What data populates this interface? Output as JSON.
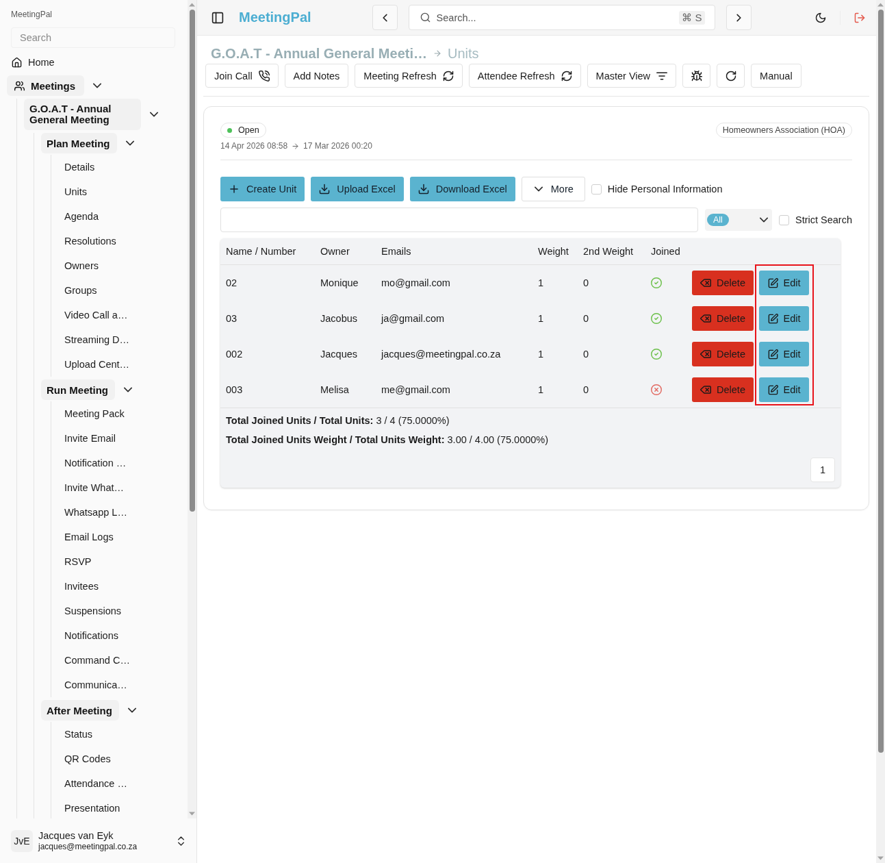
{
  "sidebar": {
    "app_name": "MeetingPal",
    "search": {
      "placeholder": "Search"
    },
    "nav": [
      {
        "kind": "link",
        "label": "Home"
      },
      {
        "kind": "group",
        "label": "Meetings",
        "expanded": true,
        "children": [
          {
            "kind": "group",
            "label": "G.O.A.T - Annual General Meeting",
            "expanded": true,
            "children": [
              {
                "kind": "group",
                "label": "Plan Meeting",
                "expanded": true,
                "children": [
                  {
                    "kind": "link",
                    "label": "Details"
                  },
                  {
                    "kind": "link",
                    "label": "Units"
                  },
                  {
                    "kind": "link",
                    "label": "Agenda"
                  },
                  {
                    "kind": "link",
                    "label": "Resolutions"
                  },
                  {
                    "kind": "link",
                    "label": "Owners"
                  },
                  {
                    "kind": "link",
                    "label": "Groups"
                  },
                  {
                    "kind": "link",
                    "label": "Video Call a…"
                  },
                  {
                    "kind": "link",
                    "label": "Streaming D…"
                  },
                  {
                    "kind": "link",
                    "label": "Upload Cent…"
                  }
                ]
              },
              {
                "kind": "group",
                "label": "Run Meeting",
                "expanded": true,
                "children": [
                  {
                    "kind": "link",
                    "label": "Meeting Pack"
                  },
                  {
                    "kind": "link",
                    "label": "Invite Email"
                  },
                  {
                    "kind": "link",
                    "label": "Notification …"
                  },
                  {
                    "kind": "link",
                    "label": "Invite What…"
                  },
                  {
                    "kind": "link",
                    "label": "Whatsapp L…"
                  },
                  {
                    "kind": "link",
                    "label": "Email Logs"
                  },
                  {
                    "kind": "link",
                    "label": "RSVP"
                  },
                  {
                    "kind": "link",
                    "label": "Invitees"
                  },
                  {
                    "kind": "link",
                    "label": "Suspensions"
                  },
                  {
                    "kind": "link",
                    "label": "Notifications"
                  },
                  {
                    "kind": "link",
                    "label": "Command C…"
                  },
                  {
                    "kind": "link",
                    "label": "Communica…"
                  }
                ]
              },
              {
                "kind": "group",
                "label": "After Meeting",
                "expanded": true,
                "children": [
                  {
                    "kind": "link",
                    "label": "Status"
                  },
                  {
                    "kind": "link",
                    "label": "QR Codes"
                  },
                  {
                    "kind": "link",
                    "label": "Attendance …"
                  },
                  {
                    "kind": "link",
                    "label": "Presentation"
                  }
                ]
              }
            ]
          }
        ]
      }
    ],
    "user": {
      "initials": "JvE",
      "name": "Jacques van Eyk",
      "email": "jacques@meetingpal.co.za"
    }
  },
  "topbar": {
    "brand": "MeetingPal",
    "search": {
      "placeholder": "Search...",
      "shortcut": "⌘ S"
    }
  },
  "breadcrumb": [
    {
      "label": "G.O.A.T - Annual General Meeti…"
    },
    {
      "label": "Units"
    }
  ],
  "actions": [
    {
      "kind": "text",
      "label": "Join Call"
    },
    {
      "kind": "text",
      "label": "Add Notes"
    },
    {
      "kind": "text",
      "label": "Meeting Refresh"
    },
    {
      "kind": "text",
      "label": "Attendee Refresh"
    },
    {
      "kind": "text",
      "label": "Master View"
    },
    {
      "kind": "icon"
    },
    {
      "kind": "icon"
    },
    {
      "kind": "text",
      "label": "Manual"
    }
  ],
  "card": {
    "status": {
      "label": "Open",
      "color": "#4ec15a"
    },
    "start": "14 Apr 2026 08:58",
    "end": "17 Mar 2026 00:20",
    "category": "Homeowners Association (HOA)",
    "toolbar": [
      {
        "kind": "primary",
        "label": "Create Unit"
      },
      {
        "kind": "primary",
        "label": "Upload Excel"
      },
      {
        "kind": "primary",
        "label": "Download Excel"
      },
      {
        "kind": "outline",
        "label": "More"
      }
    ],
    "hide_personal_info": {
      "label": "Hide Personal Information",
      "checked": false
    },
    "filter": {
      "value": "All"
    },
    "strict_search": {
      "label": "Strict Search",
      "checked": false
    },
    "table": {
      "columns": [
        "Name / Number",
        "Owner",
        "Emails",
        "Weight",
        "2nd Weight",
        "Joined"
      ],
      "rows": [
        {
          "cells": [
            "02",
            "Monique",
            "mo@gmail.com",
            "1",
            "0"
          ],
          "joined": true,
          "actions": [
            {
              "kind": "delete",
              "label": "Delete"
            },
            {
              "kind": "edit",
              "label": "Edit"
            }
          ]
        },
        {
          "cells": [
            "03",
            "Jacobus",
            "ja@gmail.com",
            "1",
            "0"
          ],
          "joined": true,
          "actions": [
            {
              "kind": "delete",
              "label": "Delete"
            },
            {
              "kind": "edit",
              "label": "Edit"
            }
          ]
        },
        {
          "cells": [
            "002",
            "Jacques",
            "jacques@meetingpal.co.za",
            "1",
            "0"
          ],
          "joined": true,
          "actions": [
            {
              "kind": "delete",
              "label": "Delete"
            },
            {
              "kind": "edit",
              "label": "Edit"
            }
          ]
        },
        {
          "cells": [
            "003",
            "Melisa",
            "me@gmail.com",
            "1",
            "0"
          ],
          "joined": false,
          "actions": [
            {
              "kind": "delete",
              "label": "Delete"
            },
            {
              "kind": "edit",
              "label": "Edit"
            }
          ]
        }
      ],
      "edit_column_highlighted": true,
      "totals": [
        "**Total Joined Units / Total Units:** 3 / 4 (75.0000%)",
        "**Total Joined Units Weight / Total Units Weight:** 3.00 / 4.00 (75.0000%)"
      ],
      "pages": [
        "1"
      ]
    }
  }
}
